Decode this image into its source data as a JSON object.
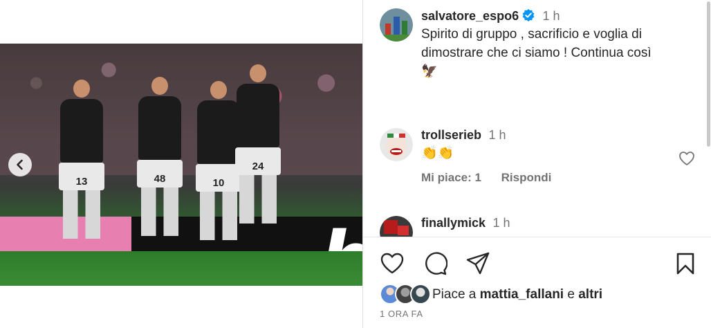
{
  "post": {
    "author": {
      "username": "salvatore_espo6",
      "time": "1 h",
      "caption": "Spirito di gruppo , sacrificio e voglia di dimostrare che ci siamo ! Continua così",
      "caption_emoji": "🦅"
    },
    "comments": [
      {
        "username": "trollserieb",
        "time": "1 h",
        "text": "👏👏",
        "likes_label": "Mi piace: 1",
        "reply_label": "Rispondi"
      },
      {
        "username": "finallymick",
        "time": "1 h"
      }
    ],
    "likes": {
      "prefix": "Piace a ",
      "user": "mattia_fallani",
      "middle": " e ",
      "suffix": "altri"
    },
    "posted": "1 ORA FA"
  },
  "photo": {
    "board_letter": "b",
    "jersey_numbers": [
      "13",
      "48",
      "10",
      "24"
    ],
    "carousel": {
      "count": 3,
      "active_index": 2
    }
  },
  "icons": [
    "chevron-left-icon",
    "verified-badge-icon",
    "heart-icon",
    "comment-icon",
    "share-icon",
    "bookmark-icon"
  ],
  "colors": {
    "verified": "#0095f6",
    "text": "#262626",
    "muted": "#737373"
  }
}
